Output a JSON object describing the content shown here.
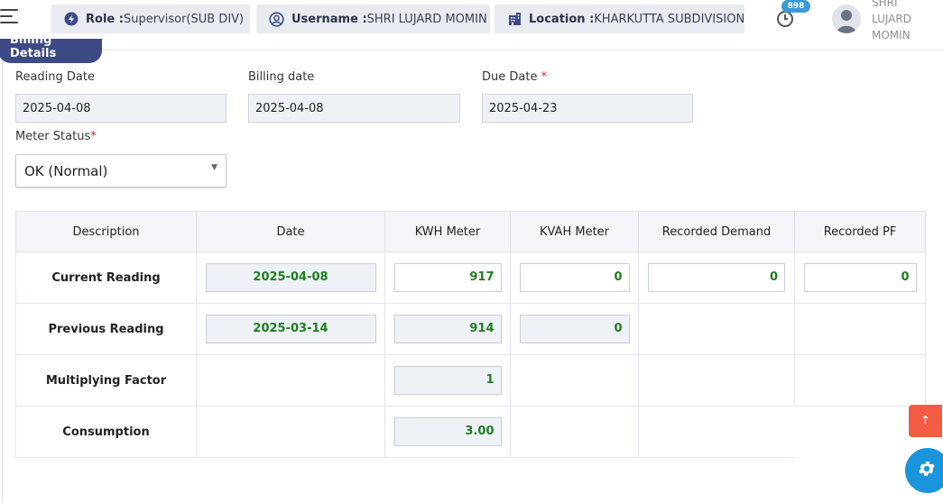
{
  "header": {
    "role_label": "Role :",
    "role_value": "Supervisor(SUB DIV)",
    "username_label": "Username :",
    "username_value": "SHRI LUJARD MOMIN",
    "location_label": "Location :",
    "location_value": "KHARKUTTA SUBDIVISION",
    "notification_count": "898",
    "user_name_lines": [
      "SHRI",
      "LUJARD",
      "MOMIN"
    ]
  },
  "section": {
    "title": "Billing Details"
  },
  "form": {
    "reading_date": {
      "label": "Reading Date",
      "value": "2025-04-08"
    },
    "billing_date": {
      "label": "Billing date",
      "value": "2025-04-08"
    },
    "due_date": {
      "label": "Due Date",
      "required_mark": "*",
      "value": "2025-04-23"
    },
    "meter_status": {
      "label": "Meter Status",
      "required_mark": "*",
      "value": "OK (Normal)"
    }
  },
  "table": {
    "headers": [
      "Description",
      "Date",
      "KWH Meter",
      "KVAH Meter",
      "Recorded Demand",
      "Recorded PF"
    ],
    "rows": {
      "current": {
        "label": "Current Reading",
        "date": "2025-04-08",
        "kwh": "917",
        "kvah": "0",
        "demand": "0",
        "pf": "0"
      },
      "previous": {
        "label": "Previous Reading",
        "date": "2025-03-14",
        "kwh": "914",
        "kvah": "0"
      },
      "multiplying": {
        "label": "Multiplying Factor",
        "kwh": "1"
      },
      "consumption": {
        "label": "Consumption",
        "kwh": "3.00"
      }
    }
  },
  "fab": {
    "up_glyph": "↑"
  },
  "colors": {
    "accent": "#3d4a86",
    "value_green": "#1e7d1e",
    "fab_red": "#f35b45",
    "fab_blue": "#1a95dc",
    "badge_blue": "#3b9ad9",
    "required_red": "#e02020"
  },
  "icons": [
    "menu-icon",
    "bolt-icon",
    "user-circle-icon",
    "building-icon",
    "clock-icon",
    "avatar-icon",
    "chevron-down-icon",
    "arrow-up-icon",
    "gear-icon"
  ]
}
